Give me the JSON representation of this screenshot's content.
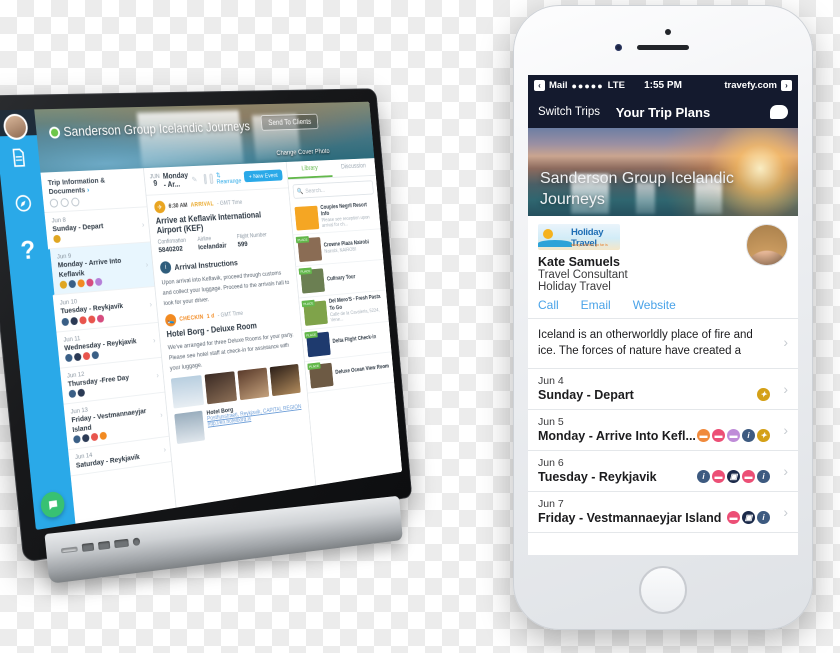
{
  "laptop": {
    "rail": {
      "avatar": "user-avatar",
      "icons": [
        "document-icon",
        "compass-icon",
        "help-icon"
      ]
    },
    "hero": {
      "title": "Sanderson Group Icelandic Journeys",
      "edit_pencil": "✎",
      "send_button": "Send To Clients",
      "change_cover": "Change Cover Photo"
    },
    "itinerary": {
      "header": "Trip Information & Documents",
      "days": [
        {
          "date": "Jun 8",
          "name": "Sunday - Depart",
          "badges": [
            "#e0a621"
          ],
          "selected": false
        },
        {
          "date": "Jun 9",
          "name": "Monday - Arrive Into Keflavik",
          "badges": [
            "#e0a621",
            "#3a5f86",
            "#f28a21",
            "#d64c7f",
            "#b57fd8"
          ],
          "selected": true
        },
        {
          "date": "Jun 10",
          "name": "Tuesday - Reykjavik",
          "badges": [
            "#3a5f86",
            "#2b3a55",
            "#e8554d",
            "#e8554d",
            "#d64c7f"
          ],
          "selected": false
        },
        {
          "date": "Jun 11",
          "name": "Wednesday - Reykjavik",
          "badges": [
            "#3a5f86",
            "#2b3a55",
            "#e8554d",
            "#3a5f86"
          ],
          "selected": false
        },
        {
          "date": "Jun 12",
          "name": "Thursday -Free Day",
          "badges": [
            "#3a5f86",
            "#2b3a55"
          ],
          "selected": false
        },
        {
          "date": "Jun 13",
          "name": "Friday - Vestmannaeyjar Island",
          "badges": [
            "#3a5f86",
            "#2b3a55",
            "#e8554d",
            "#f28a21"
          ],
          "selected": false
        },
        {
          "date": "Jun 14",
          "name": "Saturday - Reykjavik",
          "badges": [],
          "selected": false
        }
      ]
    },
    "detail": {
      "day_num": "9",
      "day_mon": "JUN",
      "day_name": "Monday - Ar...",
      "rearrange": "Rearrange",
      "new_event": "New Event",
      "event1": {
        "time": "6:30 AM",
        "kind": "ARRIVAL",
        "tz": "- GMT Time",
        "title": "Arrive at Keflavik International Airport (KEF)",
        "fields": [
          {
            "label": "Confirmation",
            "value": "5840202"
          },
          {
            "label": "Airline",
            "value": "Icelandair"
          },
          {
            "label": "Flight Number",
            "value": "599"
          }
        ]
      },
      "instructions": {
        "title": "Arrival Instructions",
        "body": "Upon arrival into Keflavik, proceed through customs and collect your luggage. Proceed to the arrivals hall to look for your driver."
      },
      "event2": {
        "time": "1 d",
        "kind": "CHECKIN",
        "tz": "- GMT Time",
        "title": "Hotel Borg - Deluxe Room",
        "body": "We've arranged for three Deluxe Rooms for your party. Please see hotel staff at check-in for assistance with your luggage."
      },
      "place": {
        "name": "Hotel Borg",
        "address": "Posthusstraeti, Reykjavik, CAPITAL REGION",
        "url": "http://en.hotelborg.is"
      }
    },
    "library": {
      "tabs": [
        {
          "label": "Library",
          "active": true
        },
        {
          "label": "Discussion",
          "active": false
        }
      ],
      "search_placeholder": "Search...",
      "items": [
        {
          "name": "Couples Negril Resort Info",
          "sub": "Please see reception upon arrival for ch...",
          "tag": "",
          "color": "#f5a623"
        },
        {
          "name": "Crowne Plaza Nairobi",
          "sub": "Nairobi, NAIROBI",
          "tag": "PLACE",
          "color": "#8a6c54"
        },
        {
          "name": "Culinary Tour",
          "sub": "",
          "tag": "PLACE",
          "color": "#6b7f52"
        },
        {
          "name": "Del Moro'S - Fresh Pasta To Go",
          "sub": "Calle de la Cavaleria, 5224, Vene...",
          "tag": "PLACE",
          "color": "#7fa34a"
        },
        {
          "name": "Delta Flight Check-in",
          "sub": "",
          "tag": "PLACE",
          "color": "#1e3a6e"
        },
        {
          "name": "Deluxe Ocean View Room",
          "sub": "",
          "tag": "PLACE",
          "color": "#6d5a44"
        }
      ]
    }
  },
  "phone": {
    "status": {
      "back_label": "Mail",
      "signal": "●●●●●",
      "carrier": "LTE",
      "time": "1:55 PM",
      "site": "travefy.com"
    },
    "nav": {
      "left": "Switch Trips",
      "title": "Your Trip Plans",
      "chat_icon": "chat-bubble-icon"
    },
    "hero_title": "Sanderson Group Icelandic Journeys",
    "agent": {
      "logo_main": "Holiday Travel",
      "logo_sub": "always ahead, go far is",
      "name": "Kate Samuels",
      "role": "Travel Consultant",
      "company": "Holiday Travel",
      "links": [
        "Call",
        "Email",
        "Website"
      ]
    },
    "description": "Iceland is an otherworldly place of fire and ice. The forces of nature have created a",
    "rows": [
      {
        "date": "Jun 4",
        "title": "Sunday - Depart",
        "icons": [
          {
            "color": "#d4a017",
            "glyph": "✦"
          }
        ]
      },
      {
        "date": "Jun 5",
        "title": "Monday - Arrive Into Kefl...",
        "icons": [
          {
            "color": "#f08a3c",
            "glyph": "▬"
          },
          {
            "color": "#ec4f76",
            "glyph": "▬"
          },
          {
            "color": "#bf8cd8",
            "glyph": "▬"
          },
          {
            "color": "#3d5a80",
            "glyph": "i"
          },
          {
            "color": "#d4a017",
            "glyph": "✦"
          }
        ]
      },
      {
        "date": "Jun 6",
        "title": "Tuesday - Reykjavik",
        "icons": [
          {
            "color": "#3d5a80",
            "glyph": "i"
          },
          {
            "color": "#ec4f76",
            "glyph": "▬"
          },
          {
            "color": "#1b2a4a",
            "glyph": "▣"
          },
          {
            "color": "#ec4f76",
            "glyph": "▬"
          },
          {
            "color": "#3d5a80",
            "glyph": "i"
          }
        ]
      },
      {
        "date": "Jun 7",
        "title": "Friday - Vestmannaeyjar Island",
        "icons": [
          {
            "color": "#ec4f76",
            "glyph": "▬"
          },
          {
            "color": "#1b2a4a",
            "glyph": "▣"
          },
          {
            "color": "#3d5a80",
            "glyph": "i"
          }
        ]
      }
    ]
  }
}
